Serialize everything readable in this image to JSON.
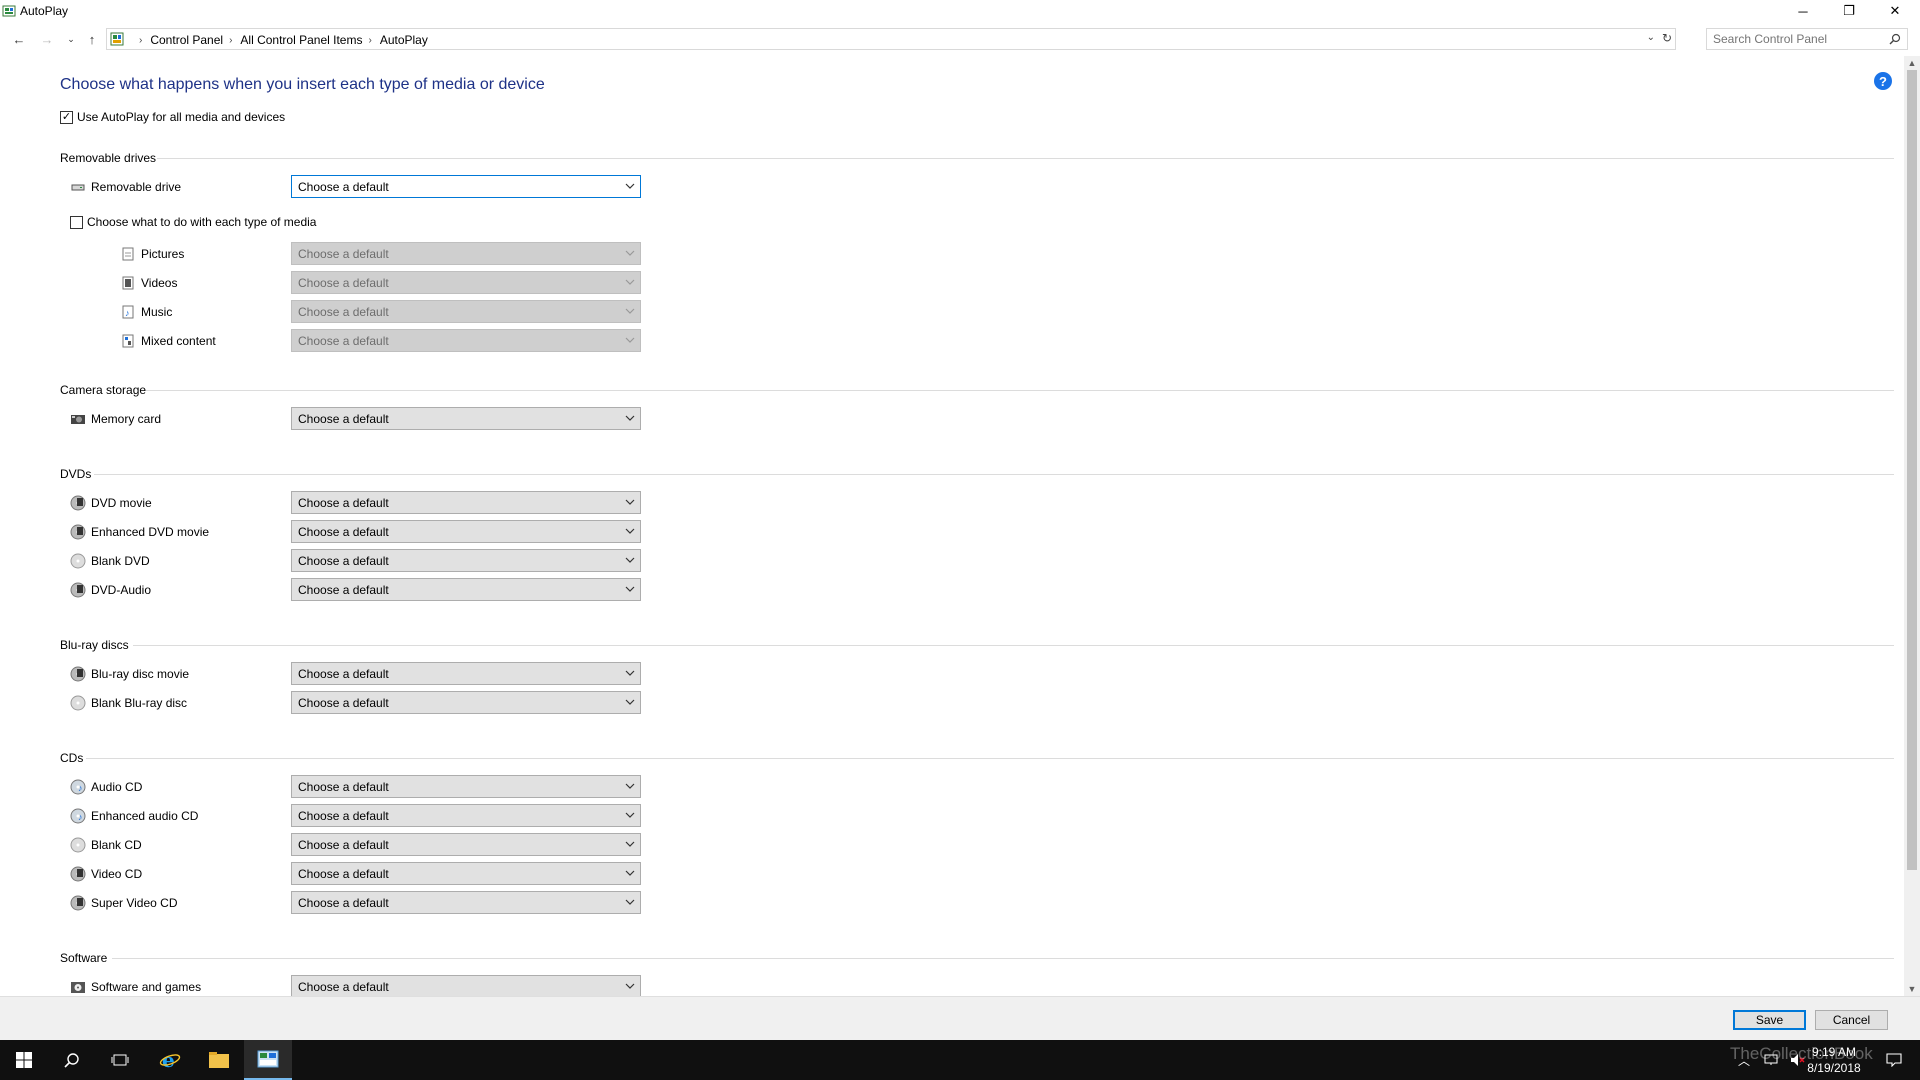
{
  "window": {
    "title": "AutoPlay",
    "controls": {
      "minimize": "─",
      "maximize": "❐",
      "close": "✕"
    }
  },
  "addressbar": {
    "breadcrumbs": [
      "Control Panel",
      "All Control Panel Items",
      "AutoPlay"
    ],
    "search_placeholder": "Search Control Panel"
  },
  "main": {
    "heading": "Choose what happens when you insert each type of media or device",
    "use_autoplay_label": "Use AutoPlay for all media and devices",
    "use_autoplay_checked": true,
    "help_icon": "?",
    "sections": {
      "removable": {
        "title": "Removable drives",
        "drive_label": "Removable drive",
        "drive_value": "Choose a default",
        "per_media_label": "Choose what to do with each type of media",
        "per_media_checked": false,
        "media": [
          {
            "label": "Pictures",
            "value": "Choose a default",
            "icon": "pictures-icon"
          },
          {
            "label": "Videos",
            "value": "Choose a default",
            "icon": "videos-icon"
          },
          {
            "label": "Music",
            "value": "Choose a default",
            "icon": "music-icon"
          },
          {
            "label": "Mixed content",
            "value": "Choose a default",
            "icon": "mixed-content-icon"
          }
        ]
      },
      "camera": {
        "title": "Camera storage",
        "items": [
          {
            "label": "Memory card",
            "value": "Choose a default",
            "icon": "memory-card-icon"
          }
        ]
      },
      "dvds": {
        "title": "DVDs",
        "items": [
          {
            "label": "DVD movie",
            "value": "Choose a default",
            "icon": "dvd-movie-icon"
          },
          {
            "label": "Enhanced DVD movie",
            "value": "Choose a default",
            "icon": "enhanced-dvd-icon"
          },
          {
            "label": "Blank DVD",
            "value": "Choose a default",
            "icon": "blank-dvd-icon"
          },
          {
            "label": "DVD-Audio",
            "value": "Choose a default",
            "icon": "dvd-audio-icon"
          }
        ]
      },
      "bluray": {
        "title": "Blu-ray discs",
        "items": [
          {
            "label": "Blu-ray disc movie",
            "value": "Choose a default",
            "icon": "bluray-movie-icon"
          },
          {
            "label": "Blank Blu-ray disc",
            "value": "Choose a default",
            "icon": "blank-bluray-icon"
          }
        ]
      },
      "cds": {
        "title": "CDs",
        "items": [
          {
            "label": "Audio CD",
            "value": "Choose a default",
            "icon": "audio-cd-icon"
          },
          {
            "label": "Enhanced audio CD",
            "value": "Choose a default",
            "icon": "enhanced-audio-cd-icon"
          },
          {
            "label": "Blank CD",
            "value": "Choose a default",
            "icon": "blank-cd-icon"
          },
          {
            "label": "Video CD",
            "value": "Choose a default",
            "icon": "video-cd-icon"
          },
          {
            "label": "Super Video CD",
            "value": "Choose a default",
            "icon": "super-video-cd-icon"
          }
        ]
      },
      "software": {
        "title": "Software",
        "items": [
          {
            "label": "Software and games",
            "value": "Choose a default",
            "icon": "software-games-icon"
          }
        ]
      }
    }
  },
  "footer": {
    "save_label": "Save",
    "cancel_label": "Cancel"
  },
  "taskbar": {
    "time": "9:19 AM",
    "date": "8/19/2018",
    "watermark": "TheCollectionBook"
  },
  "colors": {
    "heading": "#1e3287",
    "accent": "#0078d7",
    "taskbar": "#101010"
  }
}
